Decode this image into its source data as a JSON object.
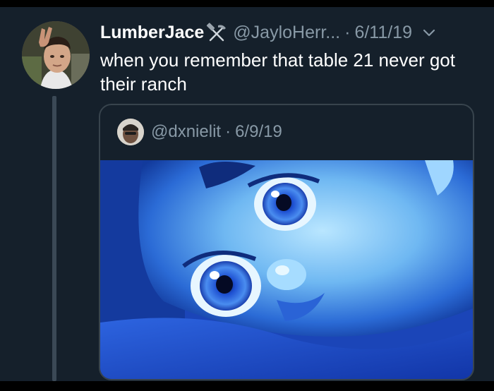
{
  "tweet": {
    "display_name": "LumberJace",
    "name_emoji": "hammer-and-pick-icon",
    "handle": "@JayloHerr...",
    "separator": "·",
    "date": "6/11/19",
    "text": "when you remember that table 21 never got their ranch"
  },
  "quoted_tweet": {
    "handle": "@dxnielit",
    "separator": "·",
    "date": "6/9/19",
    "media": "wide-eyed-cartoon-character-image"
  },
  "colors": {
    "background": "#15202b",
    "primary_text": "#ffffff",
    "secondary_text": "#8899a6",
    "border": "#38444d",
    "thread_line": "#3b4956"
  }
}
